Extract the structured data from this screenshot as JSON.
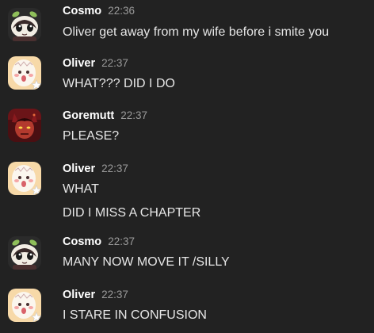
{
  "messages": [
    {
      "author": "Cosmo",
      "time": "22:36",
      "avatar_icon": "cosmo-avatar",
      "lines": [
        "Oliver get away from my wife before i smite you"
      ]
    },
    {
      "author": "Oliver",
      "time": "22:37",
      "avatar_icon": "oliver-avatar",
      "lines": [
        "WHAT??? DID I DO"
      ]
    },
    {
      "author": "Goremutt",
      "time": "22:37",
      "avatar_icon": "goremutt-avatar",
      "lines": [
        "PLEASE?"
      ]
    },
    {
      "author": "Oliver",
      "time": "22:37",
      "avatar_icon": "oliver-avatar",
      "lines": [
        "WHAT",
        "DID I MISS A CHAPTER"
      ]
    },
    {
      "author": "Cosmo",
      "time": "22:37",
      "avatar_icon": "cosmo-avatar",
      "lines": [
        "MANY NOW MOVE IT /SILLY"
      ]
    },
    {
      "author": "Oliver",
      "time": "22:37",
      "avatar_icon": "oliver-avatar",
      "lines": [
        "I STARE IN CONFUSION"
      ]
    }
  ],
  "colors": {
    "background": "#222222",
    "author_name": "#ffffff",
    "timestamp": "#9a9a9a",
    "message_text": "#e6e6e6"
  }
}
